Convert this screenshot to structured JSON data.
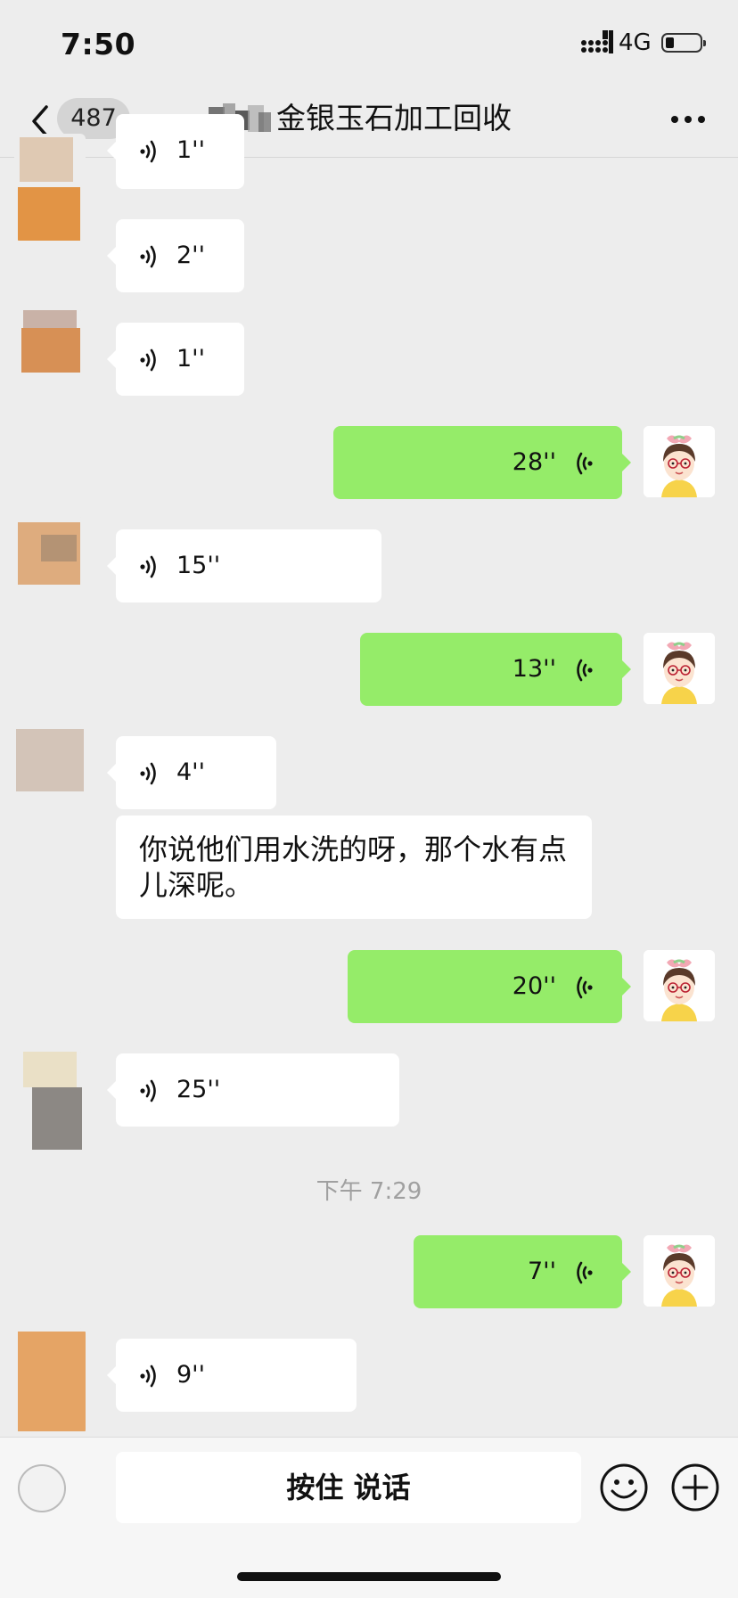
{
  "status_bar": {
    "time": "7:50",
    "network": "4G",
    "battery_level": 0.25
  },
  "nav": {
    "back_count": "487",
    "title": "金银玉石加工回收"
  },
  "messages": [
    {
      "side": "in",
      "duration": "1''"
    },
    {
      "side": "in",
      "duration": "2''"
    },
    {
      "side": "in",
      "duration": "1''"
    },
    {
      "side": "out",
      "duration": "28''"
    },
    {
      "side": "in",
      "duration": "15''"
    },
    {
      "side": "out",
      "duration": "13''"
    },
    {
      "side": "in",
      "duration": "4''"
    },
    {
      "side": "in",
      "text": "你说他们用水洗的呀，那个水有点儿深呢。"
    },
    {
      "side": "out",
      "duration": "20''"
    },
    {
      "side": "in",
      "duration": "25''"
    },
    {
      "side": "out",
      "duration": "7''"
    },
    {
      "side": "in",
      "duration": "9''"
    }
  ],
  "timestamp": "下午 7:29",
  "input_bar": {
    "hold_to_talk_label": "按住 说话"
  },
  "icons": {
    "back": "chevron-left-icon",
    "more": "more-dots-icon",
    "voice_in": "voice-wave-icon",
    "voice_out": "voice-wave-icon",
    "emoji": "smiley-icon",
    "plus": "plus-circle-icon"
  },
  "colors": {
    "background": "#ededed",
    "outgoing_bubble": "#95ec69",
    "incoming_bubble": "#ffffff",
    "timestamp": "#a0a0a0"
  }
}
